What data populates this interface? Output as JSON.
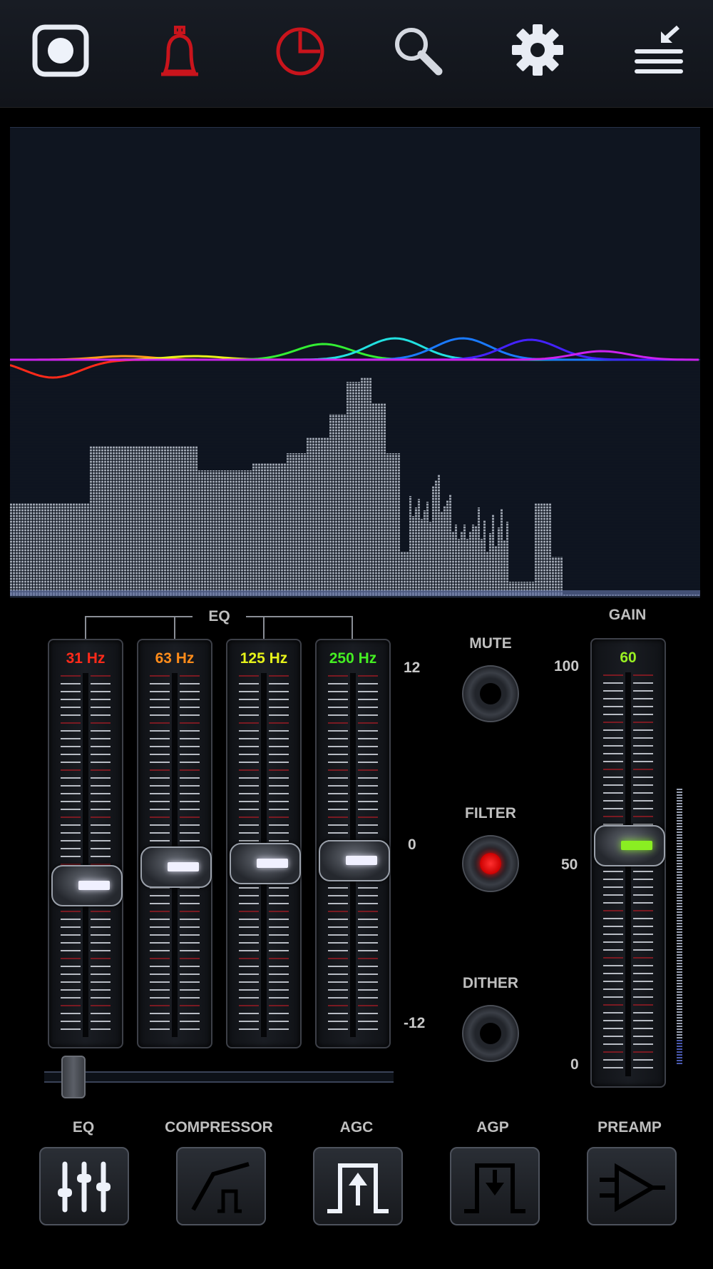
{
  "eq_group_label": "EQ",
  "gain_label": "GAIN",
  "eq_bands": [
    {
      "label": "31 Hz",
      "color": "#ff2a1a",
      "level": 0.42
    },
    {
      "label": "63 Hz",
      "color": "#ff8c1a",
      "level": 0.48
    },
    {
      "label": "125 Hz",
      "color": "#e6f21a",
      "level": 0.49
    },
    {
      "label": "250 Hz",
      "color": "#44ee22",
      "level": 0.5
    }
  ],
  "eq_scale": {
    "max": "12",
    "mid": "0",
    "min": "-12"
  },
  "gain": {
    "value": "60",
    "color": "#99f022",
    "level": 0.6
  },
  "gain_scale": {
    "max": "100",
    "mid": "50",
    "min": "0"
  },
  "toggles": {
    "mute": "MUTE",
    "filter": "FILTER",
    "dither": "DITHER",
    "filter_on": true
  },
  "bottom_buttons": [
    {
      "label": "EQ",
      "icon": "eq-sliders-icon"
    },
    {
      "label": "COMPRESSOR",
      "icon": "compressor-curve-icon"
    },
    {
      "label": "AGC",
      "icon": "agc-icon"
    },
    {
      "label": "AGP",
      "icon": "agp-icon"
    },
    {
      "label": "PREAMP",
      "icon": "preamp-icon"
    }
  ],
  "toolbar_icons": [
    "record-icon",
    "alarm-bell-icon",
    "timer-icon",
    "search-icon",
    "settings-gear-icon",
    "minimize-menu-icon"
  ]
}
